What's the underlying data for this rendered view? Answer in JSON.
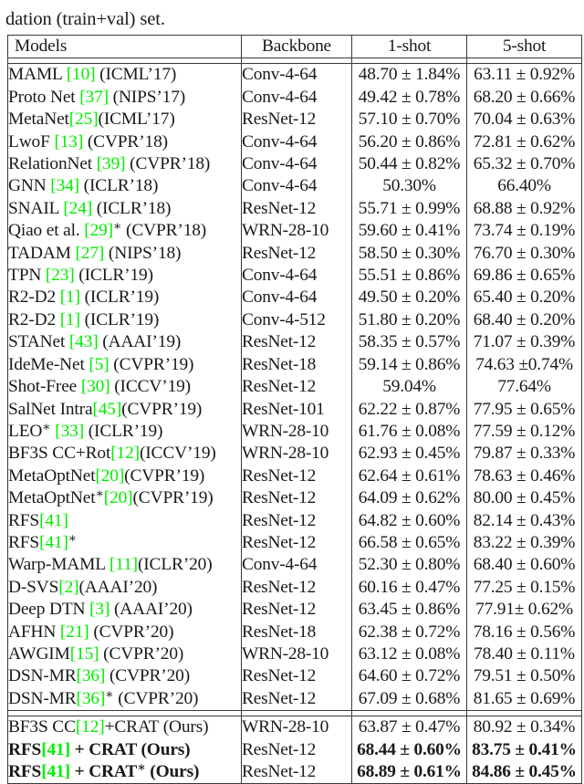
{
  "page": {
    "cutoff_line": "  ,     ,    ,     ,     ,      ,       ,        ,     ,      ,      ,       ,      ,     ,      ",
    "caption_tail": "dation (train+val) set."
  },
  "table": {
    "columns": [
      {
        "key": "model",
        "label": "Models",
        "align": "left"
      },
      {
        "key": "backbone",
        "label": "Backbone",
        "align": "center"
      },
      {
        "key": "oneshot",
        "label": "1-shot",
        "align": "center"
      },
      {
        "key": "fiveshot",
        "label": "5-shot",
        "align": "center"
      }
    ],
    "citation_color": "#00ee00",
    "rows": [
      {
        "name": "MAML",
        "cite": "10",
        "venue": "(ICML'17)",
        "star": false,
        "model_text": "MAML [10] (ICML’17)",
        "backbone": "Conv-4-64",
        "oneshot": "48.70 ± 1.84%",
        "fiveshot": "63.11 ± 0.92%",
        "bold": false
      },
      {
        "name": "Proto Net",
        "cite": "37",
        "venue": "(NIPS'17)",
        "star": false,
        "model_text": "Proto Net [37] (NIPS’17)",
        "backbone": "Conv-4-64",
        "oneshot": "49.42 ± 0.78%",
        "fiveshot": "68.20 ± 0.66%",
        "bold": false
      },
      {
        "name": "MetaNet",
        "cite": "25",
        "venue": "(ICML'17)",
        "star": false,
        "model_text": "MetaNet[25](ICML’17)",
        "backbone": "ResNet-12",
        "oneshot": "57.10 ± 0.70%",
        "fiveshot": "70.04 ± 0.63%",
        "bold": false
      },
      {
        "name": "LwoF",
        "cite": "13",
        "venue": "(CVPR'18)",
        "star": false,
        "model_text": "LwoF [13] (CVPR’18)",
        "backbone": "Conv-4-64",
        "oneshot": "56.20 ± 0.86%",
        "fiveshot": "72.81 ± 0.62%",
        "bold": false
      },
      {
        "name": "RelationNet",
        "cite": "39",
        "venue": "(CVPR'18)",
        "star": false,
        "model_text": "RelationNet [39] (CVPR’18)",
        "backbone": "Conv-4-64",
        "oneshot": "50.44 ± 0.82%",
        "fiveshot": "65.32 ± 0.70%",
        "bold": false
      },
      {
        "name": "GNN",
        "cite": "34",
        "venue": "(ICLR'18)",
        "star": false,
        "model_text": "GNN [34] (ICLR’18)",
        "backbone": "Conv-4-64",
        "oneshot": "50.30%",
        "fiveshot": "66.40%",
        "bold": false
      },
      {
        "name": "SNAIL",
        "cite": "24",
        "venue": "(ICLR'18)",
        "star": false,
        "model_text": "SNAIL [24] (ICLR’18)",
        "backbone": "ResNet-12",
        "oneshot": "55.71 ± 0.99%",
        "fiveshot": "68.88 ± 0.92%",
        "bold": false
      },
      {
        "name": "Qiao et al.",
        "cite": "29",
        "venue": "(CVPR'18)",
        "star": true,
        "model_text": "Qiao et al. [29]* (CVPR’18)",
        "backbone": "WRN-28-10",
        "oneshot": "59.60 ± 0.41%",
        "fiveshot": "73.74 ± 0.19%",
        "bold": false
      },
      {
        "name": "TADAM",
        "cite": "27",
        "venue": "(NIPS'18)",
        "star": false,
        "model_text": "TADAM [27] (NIPS’18)",
        "backbone": "ResNet-12",
        "oneshot": "58.50 ± 0.30%",
        "fiveshot": "76.70 ± 0.30%",
        "bold": false
      },
      {
        "name": "TPN",
        "cite": "23",
        "venue": "(ICLR'19)",
        "star": false,
        "model_text": "TPN [23] (ICLR’19)",
        "backbone": "Conv-4-64",
        "oneshot": "55.51 ± 0.86%",
        "fiveshot": "69.86 ± 0.65%",
        "bold": false
      },
      {
        "name": "R2-D2",
        "cite": "1",
        "venue": "(ICLR'19)",
        "star": false,
        "model_text": "R2-D2 [1] (ICLR’19)",
        "backbone": "Conv-4-64",
        "oneshot": "49.50 ± 0.20%",
        "fiveshot": "65.40 ± 0.20%",
        "bold": false
      },
      {
        "name": "R2-D2",
        "cite": "1",
        "venue": "(ICLR'19)",
        "star": false,
        "model_text": "R2-D2 [1] (ICLR’19)",
        "backbone": "Conv-4-512",
        "oneshot": "51.80 ± 0.20%",
        "fiveshot": "68.40 ± 0.20%",
        "bold": false
      },
      {
        "name": "STANet",
        "cite": "43",
        "venue": "(AAAI'19)",
        "star": false,
        "model_text": "STANet [43] (AAAI’19)",
        "backbone": "ResNet-12",
        "oneshot": "58.35 ± 0.57%",
        "fiveshot": "71.07 ± 0.39%",
        "bold": false
      },
      {
        "name": "IdeMe-Net",
        "cite": "5",
        "venue": "(CVPR'19)",
        "star": false,
        "model_text": "IdeMe-Net [5] (CVPR’19)",
        "backbone": "ResNet-18",
        "oneshot": "59.14 ± 0.86%",
        "fiveshot": "74.63 ±0.74%",
        "bold": false
      },
      {
        "name": "Shot-Free",
        "cite": "30",
        "venue": "(ICCV'19)",
        "star": false,
        "model_text": "Shot-Free [30] (ICCV’19)",
        "backbone": "ResNet-12",
        "oneshot": "59.04%",
        "fiveshot": "77.64%",
        "bold": false
      },
      {
        "name": "SalNet Intra",
        "cite": "45",
        "venue": "(CVPR'19)",
        "star": false,
        "model_text": "SalNet Intra[45](CVPR’19)",
        "backbone": "ResNet-101",
        "oneshot": "62.22 ± 0.87%",
        "fiveshot": "77.95 ± 0.65%",
        "bold": false
      },
      {
        "name": "LEO*",
        "cite": "33",
        "venue": "(ICLR'19)",
        "star": false,
        "model_text": "LEO* [33] (ICLR’19)",
        "backbone": "WRN-28-10",
        "oneshot": "61.76 ± 0.08%",
        "fiveshot": "77.59 ± 0.12%",
        "bold": false
      },
      {
        "name": "BF3S CC+Rot",
        "cite": "12",
        "venue": "(ICCV'19)",
        "star": false,
        "model_text": "BF3S CC+Rot[12](ICCV’19)",
        "backbone": "WRN-28-10",
        "oneshot": "62.93 ± 0.45%",
        "fiveshot": "79.87 ± 0.33%",
        "bold": false
      },
      {
        "name": "MetaOptNet",
        "cite": "20",
        "venue": "(CVPR'19)",
        "star": false,
        "model_text": "MetaOptNet[20](CVPR’19)",
        "backbone": "ResNet-12",
        "oneshot": "62.64 ± 0.61%",
        "fiveshot": "78.63 ± 0.46%",
        "bold": false
      },
      {
        "name": "MetaOptNet*",
        "cite": "20",
        "venue": "(CVPR'19)",
        "star": true,
        "model_text": "MetaOptNet*[20](CVPR’19)",
        "backbone": "ResNet-12",
        "oneshot": "64.09 ± 0.62%",
        "fiveshot": "80.00 ± 0.45%",
        "bold": false
      },
      {
        "name": "RFS",
        "cite": "41",
        "venue": "",
        "star": false,
        "model_text": "RFS[41]",
        "backbone": "ResNet-12",
        "oneshot": "64.82 ± 0.60%",
        "fiveshot": "82.14 ± 0.43%",
        "bold": false
      },
      {
        "name": "RFS",
        "cite": "41",
        "venue": "",
        "star": true,
        "model_text": "RFS[41]*",
        "backbone": "ResNet-12",
        "oneshot": "66.58 ± 0.65%",
        "fiveshot": "83.22 ± 0.39%",
        "bold": false
      },
      {
        "name": "Warp-MAML",
        "cite": "11",
        "venue": "(ICLR'20)",
        "star": false,
        "model_text": "Warp-MAML [11](ICLR’20)",
        "backbone": "Conv-4-64",
        "oneshot": "52.30 ± 0.80%",
        "fiveshot": "68.40 ± 0.60%",
        "bold": false
      },
      {
        "name": "D-SVS",
        "cite": "2",
        "venue": "(AAAI'20)",
        "star": false,
        "model_text": "D-SVS[2](AAAI’20)",
        "backbone": "ResNet-12",
        "oneshot": "60.16 ± 0.47%",
        "fiveshot": "77.25 ± 0.15%",
        "bold": false
      },
      {
        "name": "Deep DTN",
        "cite": "3",
        "venue": "(AAAI'20)",
        "star": false,
        "model_text": "Deep DTN [3] (AAAI’20)",
        "backbone": "ResNet-12",
        "oneshot": "63.45 ± 0.86%",
        "fiveshot": "77.91± 0.62%",
        "bold": false
      },
      {
        "name": "AFHN",
        "cite": "21",
        "venue": "(CVPR'20)",
        "star": false,
        "model_text": "AFHN [21] (CVPR’20)",
        "backbone": "ResNet-18",
        "oneshot": "62.38 ± 0.72%",
        "fiveshot": "78.16 ± 0.56%",
        "bold": false
      },
      {
        "name": "AWGIM",
        "cite": "15",
        "venue": "(CVPR'20)",
        "star": false,
        "model_text": "AWGIM[15] (CVPR’20)",
        "backbone": "WRN-28-10",
        "oneshot": "63.12 ± 0.08%",
        "fiveshot": "78.40 ± 0.11%",
        "bold": false
      },
      {
        "name": "DSN-MR",
        "cite": "36",
        "venue": "(CVPR'20)",
        "star": false,
        "model_text": "DSN-MR[36] (CVPR’20)",
        "backbone": "ResNet-12",
        "oneshot": "64.60 ± 0.72%",
        "fiveshot": "79.51 ± 0.50%",
        "bold": false
      },
      {
        "name": "DSN-MR",
        "cite": "36",
        "venue": "(CVPR'20)",
        "star": true,
        "model_text": "DSN-MR[36]* (CVPR’20)",
        "backbone": "ResNet-12",
        "oneshot": "67.09 ± 0.68%",
        "fiveshot": "81.65 ± 0.69%",
        "bold": false
      }
    ],
    "ours_rows": [
      {
        "name": "BF3S CC",
        "cite": "12",
        "venue": "(Ours)",
        "star": false,
        "model_text": "BF3S CC[12]+CRAT (Ours)",
        "backbone": "WRN-28-10",
        "oneshot": "63.87 ± 0.47%",
        "fiveshot": "80.92 ± 0.34%",
        "bold": false
      },
      {
        "name": "RFS + CRAT",
        "cite": "41",
        "venue": "(Ours)",
        "star": false,
        "model_text": "RFS[41] + CRAT (Ours)",
        "backbone": "ResNet-12",
        "oneshot": "68.44 ± 0.60%",
        "fiveshot": "83.75 ± 0.41%",
        "bold": true
      },
      {
        "name": "RFS + CRAT*",
        "cite": "41",
        "venue": "(Ours)",
        "star": true,
        "model_text": "RFS[41] + CRAT* (Ours)",
        "backbone": "ResNet-12",
        "oneshot": "68.89 ± 0.61%",
        "fiveshot": "84.86 ± 0.45%",
        "bold": true
      }
    ]
  }
}
